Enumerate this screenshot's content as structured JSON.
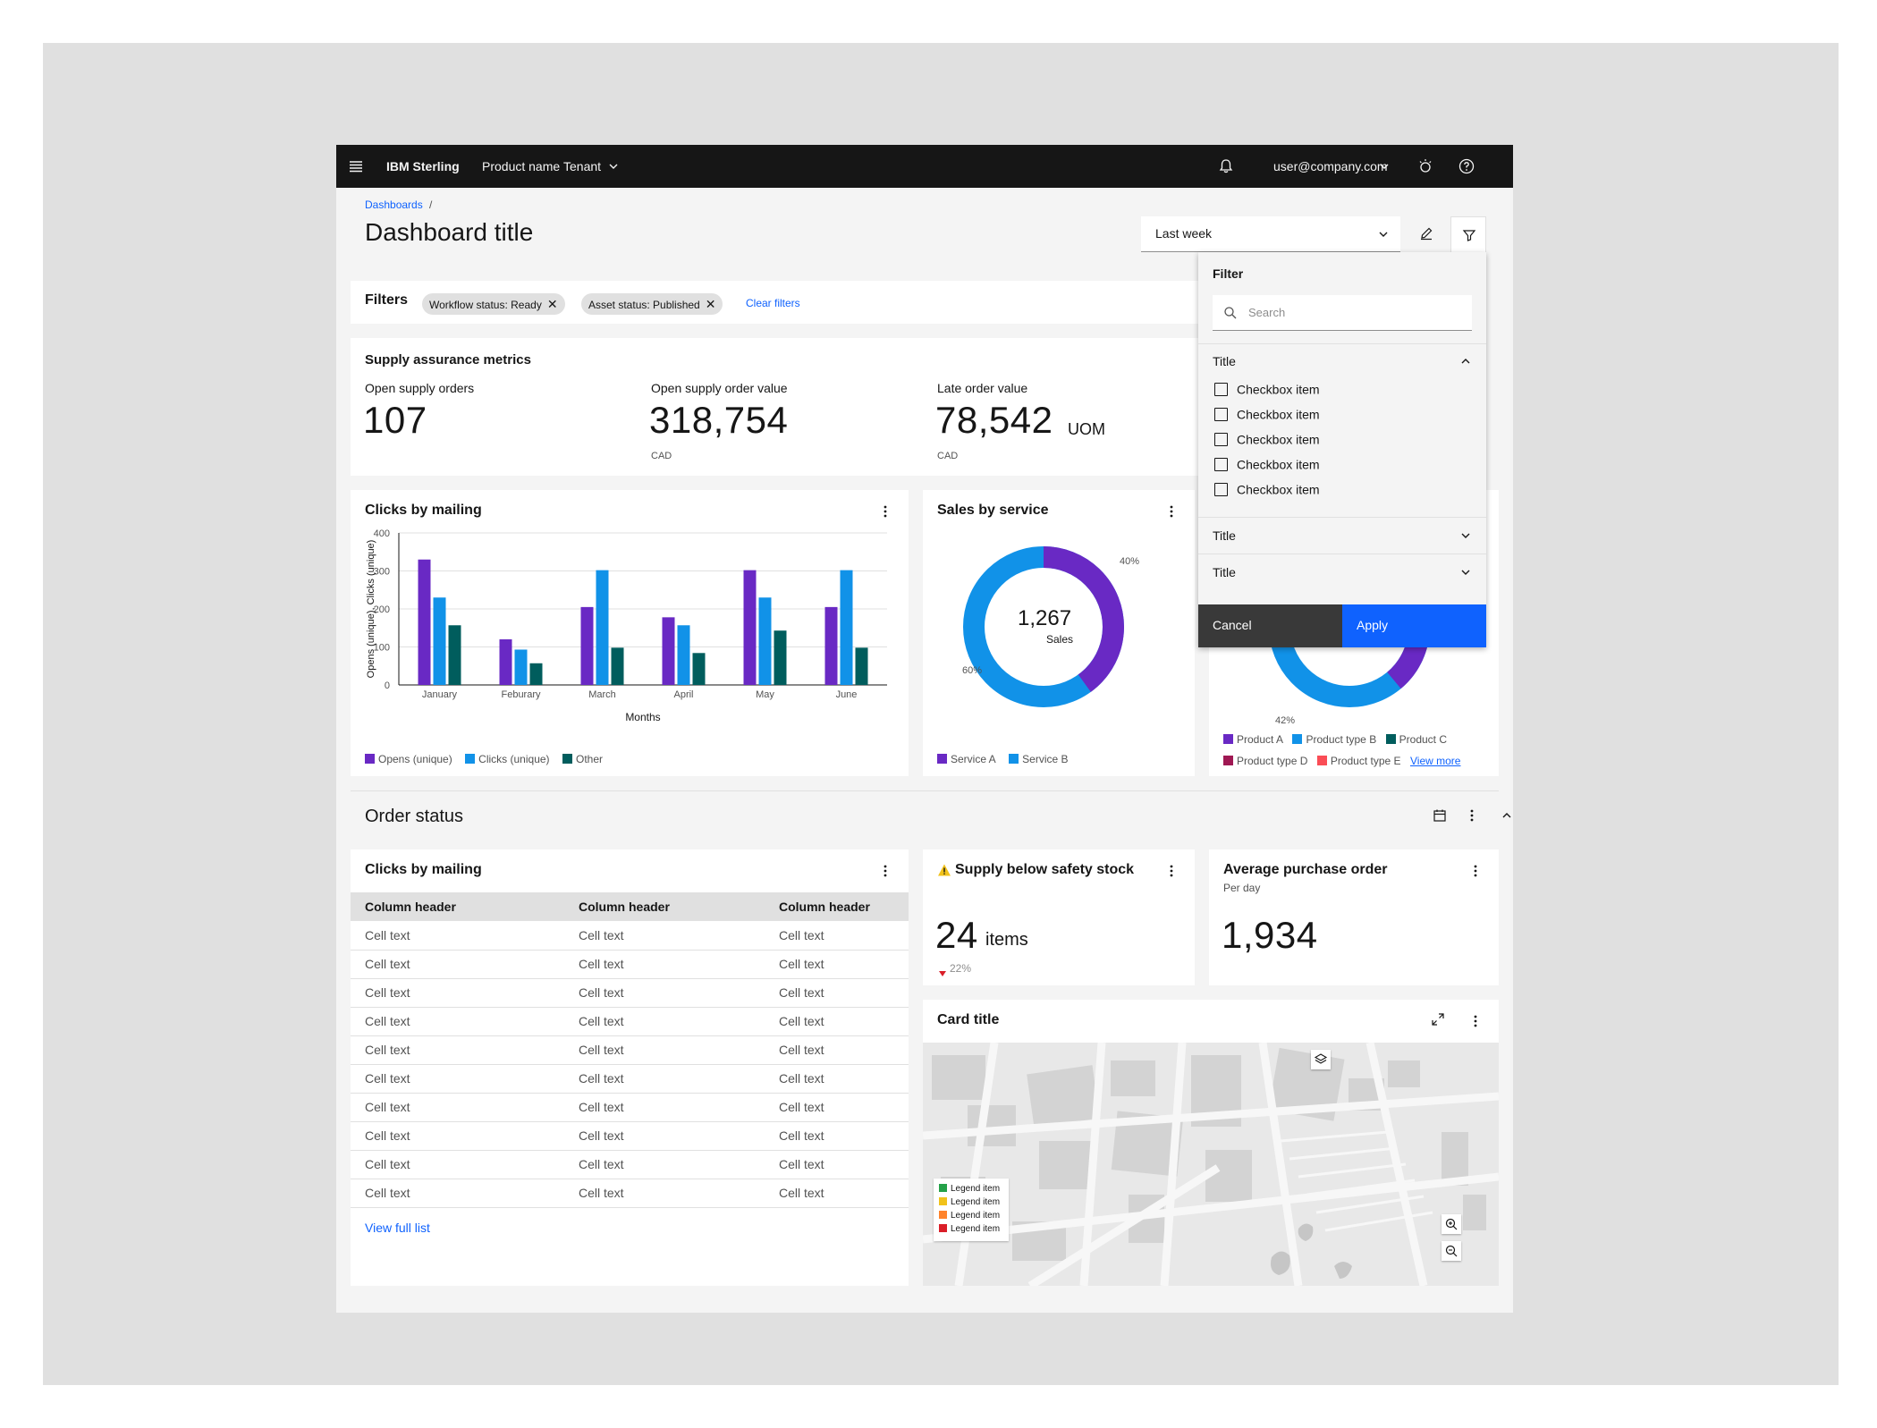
{
  "header": {
    "brand": "IBM Sterling",
    "product": "Product name",
    "tenant": "Tenant",
    "user": "user@company.com"
  },
  "page": {
    "breadcrumb": "Dashboards",
    "breadcrumb_sep": "/",
    "title": "Dashboard title",
    "date_range": "Last week"
  },
  "filters": {
    "label": "Filters",
    "tags": [
      "Workflow status: Ready",
      "Asset status: Published"
    ],
    "clear": "Clear filters"
  },
  "filter_panel": {
    "title": "Filter",
    "search_placeholder": "Search",
    "section1": "Title",
    "checkboxes": [
      "Checkbox item",
      "Checkbox item",
      "Checkbox item",
      "Checkbox item",
      "Checkbox item"
    ],
    "section2": "Title",
    "section3": "Title",
    "cancel": "Cancel",
    "apply": "Apply"
  },
  "metrics": {
    "title": "Supply assurance metrics",
    "items": [
      {
        "label": "Open supply orders",
        "value": "107",
        "unit": "",
        "sub": ""
      },
      {
        "label": "Open supply order value",
        "value": "318,754",
        "unit": "",
        "sub": "CAD"
      },
      {
        "label": "Late order value",
        "value": "78,542",
        "unit": "UOM",
        "sub": "CAD"
      }
    ]
  },
  "clicks_card": {
    "title": "Clicks by mailing",
    "xlabel": "Months",
    "ylabel": "Opens (unique), Clicks (unique)"
  },
  "sales_card": {
    "title": "Sales by service",
    "center_value": "1,267",
    "center_label": "Sales",
    "pct_a": "40%",
    "pct_b": "60%",
    "legend": [
      "Service A",
      "Service B"
    ]
  },
  "product_card": {
    "pct": "42%",
    "legend": [
      "Product A",
      "Product type B",
      "Product C",
      "Product type D",
      "Product type E"
    ],
    "view_more": "View more"
  },
  "order_status": {
    "title": "Order status"
  },
  "table_card": {
    "title": "Clicks by mailing",
    "headers": [
      "Column header",
      "Column header",
      "Column header"
    ],
    "rows": [
      [
        "Cell text",
        "Cell text",
        "Cell text"
      ],
      [
        "Cell text",
        "Cell text",
        "Cell text"
      ],
      [
        "Cell text",
        "Cell text",
        "Cell text"
      ],
      [
        "Cell text",
        "Cell text",
        "Cell text"
      ],
      [
        "Cell text",
        "Cell text",
        "Cell text"
      ],
      [
        "Cell text",
        "Cell text",
        "Cell text"
      ],
      [
        "Cell text",
        "Cell text",
        "Cell text"
      ],
      [
        "Cell text",
        "Cell text",
        "Cell text"
      ],
      [
        "Cell text",
        "Cell text",
        "Cell text"
      ],
      [
        "Cell text",
        "Cell text",
        "Cell text"
      ]
    ],
    "view_full": "View full list"
  },
  "stock_card": {
    "title": "Supply below safety stock",
    "value": "24",
    "unit": "items",
    "delta": "22%"
  },
  "avg_card": {
    "title": "Average purchase order",
    "subtitle": "Per day",
    "value": "1,934"
  },
  "map_card": {
    "title": "Card title",
    "legend": [
      "Legend item",
      "Legend item",
      "Legend item",
      "Legend item"
    ],
    "legend_colors": [
      "#24a148",
      "#f1c21b",
      "#ff832b",
      "#da1e28"
    ]
  },
  "colors": {
    "purple": "#6929c4",
    "cyan": "#1192e8",
    "teal": "#005d5d",
    "magenta": "#9f1853",
    "red": "#fa4d56",
    "blue": "#0f62fe"
  },
  "chart_data": {
    "type": "bar",
    "categories": [
      "January",
      "Feburary",
      "March",
      "April",
      "May",
      "June"
    ],
    "series": [
      {
        "name": "Opens (unique)",
        "values": [
          330,
          120,
          205,
          178,
          302,
          205
        ]
      },
      {
        "name": "Clicks (unique)",
        "values": [
          230,
          93,
          302,
          157,
          230,
          302
        ]
      },
      {
        "name": "Other",
        "values": [
          157,
          57,
          98,
          84,
          143,
          98
        ]
      }
    ],
    "xlabel": "Months",
    "ylabel": "Opens (unique), Clicks (unique)",
    "ylim": [
      0,
      400
    ],
    "yticks": [
      0,
      100,
      200,
      300,
      400
    ],
    "grid": true,
    "legend": "bottom-left"
  }
}
